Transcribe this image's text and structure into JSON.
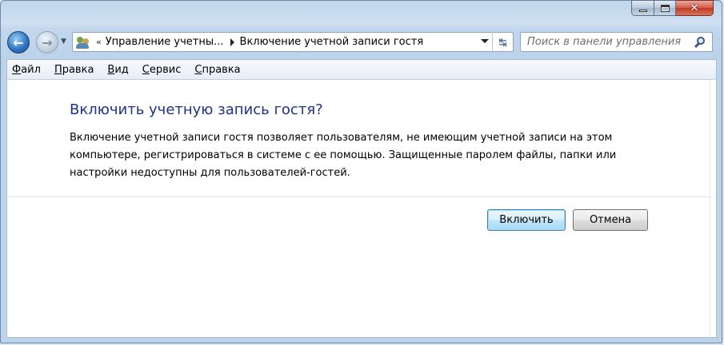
{
  "window": {
    "caption_buttons": {
      "minimize_icon": "minimize-icon",
      "maximize_icon": "maximize-icon",
      "close_icon": "close-icon"
    }
  },
  "navigation": {
    "back_icon": "back-arrow-icon",
    "forward_icon": "forward-arrow-icon",
    "breadcrumb": {
      "overflow": "«",
      "items": [
        "Управление учетны...",
        "Включение учетной записи гостя"
      ]
    },
    "search": {
      "placeholder": "Поиск в панели управления"
    }
  },
  "menu": {
    "items": [
      {
        "label": "Файл",
        "accel": "Ф",
        "rest": "айл"
      },
      {
        "label": "Правка",
        "accel": "П",
        "rest": "равка"
      },
      {
        "label": "Вид",
        "accel": "В",
        "rest": "ид"
      },
      {
        "label": "Сервис",
        "accel": "С",
        "rest": "ервис"
      },
      {
        "label": "Справка",
        "accel": "С",
        "rest": "правка"
      }
    ]
  },
  "content": {
    "heading": "Включить учетную запись гостя?",
    "description": "Включение учетной записи гостя позволяет пользователям, не имеющим учетной записи на этом компьютере, регистрироваться в системе с ее помощью. Защищенные паролем файлы, папки или настройки недоступны для пользователей-гостей.",
    "buttons": {
      "enable": "Включить",
      "cancel": "Отмена"
    }
  },
  "colors": {
    "heading": "#1e3287",
    "primary_button_border": "#3c7fb1"
  }
}
